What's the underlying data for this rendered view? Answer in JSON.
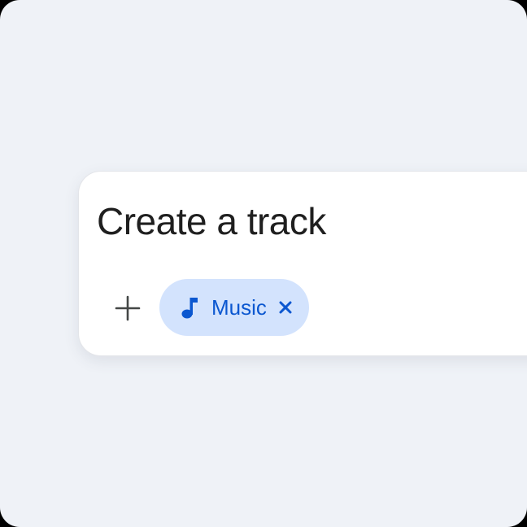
{
  "prompt": {
    "text": "Create a track",
    "add_button_icon": "plus-icon"
  },
  "chip": {
    "label": "Music",
    "icon": "music-note-icon",
    "remove_icon": "close-icon"
  },
  "colors": {
    "background": "#eff2f7",
    "card": "#ffffff",
    "chip_background": "#d3e3fd",
    "chip_accent": "#0b57d0",
    "text": "#1f1f1f",
    "icon": "#444746"
  }
}
